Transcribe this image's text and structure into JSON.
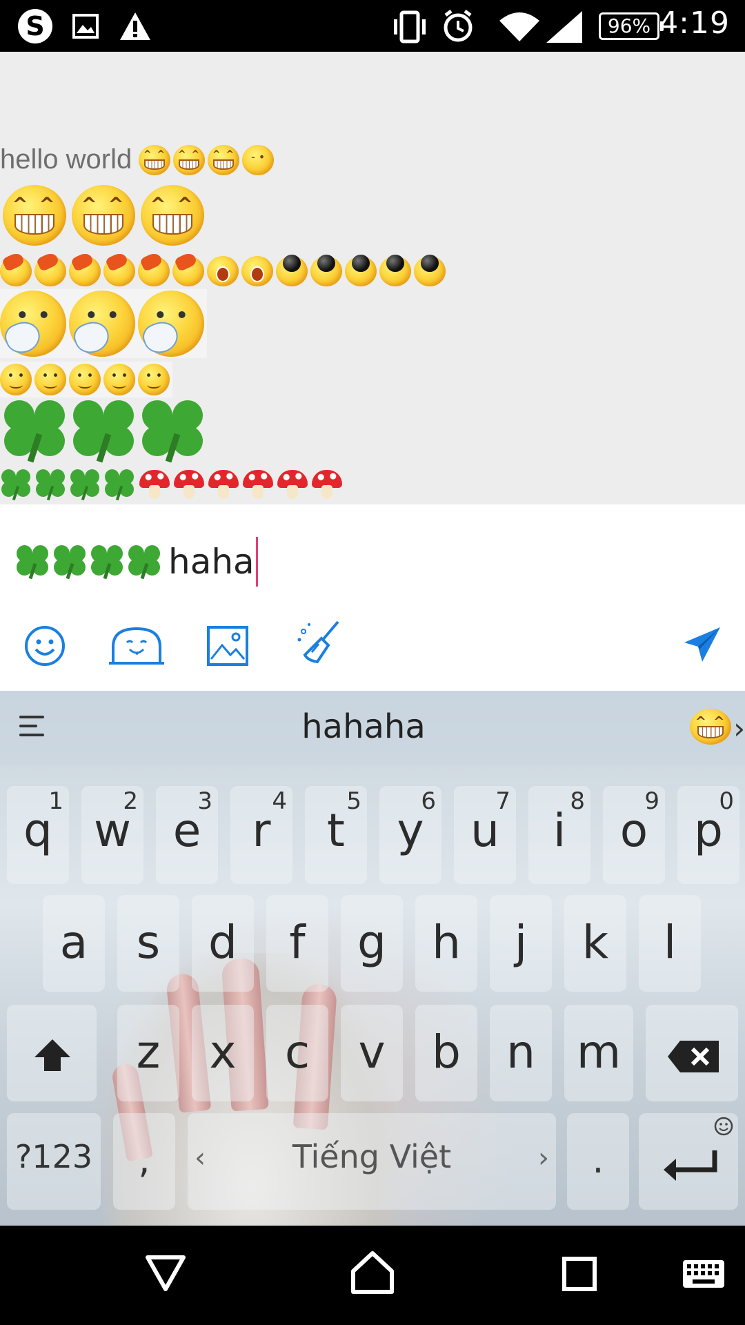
{
  "status_bar": {
    "time": "4:19",
    "battery": "96%",
    "icons": [
      "skype-icon",
      "image-icon",
      "warning-icon",
      "vibrate-icon",
      "alarm-icon",
      "wifi-icon",
      "signal-icon"
    ]
  },
  "chat": {
    "message_text": "hello world",
    "rows": [
      {
        "type": "text-with-emoji",
        "emojis": [
          "grin",
          "grin",
          "grin",
          "wink"
        ]
      },
      {
        "type": "emoji",
        "emojis": [
          "grin",
          "grin",
          "grin"
        ]
      },
      {
        "type": "emoji",
        "emojis": [
          "bag",
          "bag",
          "bag",
          "bag",
          "bag",
          "bag",
          "shock",
          "shock",
          "bomb",
          "bomb",
          "bomb",
          "bomb",
          "bomb"
        ]
      },
      {
        "type": "emoji",
        "emojis": [
          "blush",
          "blush",
          "blush"
        ]
      },
      {
        "type": "emoji",
        "emojis": [
          "smile",
          "smile",
          "smile",
          "smile",
          "smile"
        ]
      },
      {
        "type": "emoji",
        "emojis": [
          "clover",
          "clover",
          "clover"
        ]
      },
      {
        "type": "emoji",
        "emojis": [
          "clover",
          "clover",
          "clover",
          "clover",
          "mushroom",
          "mushroom",
          "mushroom",
          "mushroom",
          "mushroom",
          "mushroom"
        ]
      }
    ]
  },
  "compose": {
    "text": "haha",
    "prefix_emojis": [
      "clover",
      "clover",
      "clover",
      "clover"
    ],
    "tools": [
      "emoji-icon",
      "sticker-icon",
      "image-icon",
      "clean-icon"
    ],
    "send": "send-icon",
    "accent": "#1a7fe0"
  },
  "keyboard": {
    "suggestion": "hahaha",
    "row1": [
      {
        "key": "q",
        "hint": "1"
      },
      {
        "key": "w",
        "hint": "2"
      },
      {
        "key": "e",
        "hint": "3"
      },
      {
        "key": "r",
        "hint": "4"
      },
      {
        "key": "t",
        "hint": "5"
      },
      {
        "key": "y",
        "hint": "6"
      },
      {
        "key": "u",
        "hint": "7"
      },
      {
        "key": "i",
        "hint": "8"
      },
      {
        "key": "o",
        "hint": "9"
      },
      {
        "key": "p",
        "hint": "0"
      }
    ],
    "row2": [
      "a",
      "s",
      "d",
      "f",
      "g",
      "h",
      "j",
      "k",
      "l"
    ],
    "row3": [
      "z",
      "x",
      "c",
      "v",
      "b",
      "n",
      "m"
    ],
    "symbols": "?123",
    "comma": ",",
    "space": "Tiếng Việt",
    "period": "."
  }
}
